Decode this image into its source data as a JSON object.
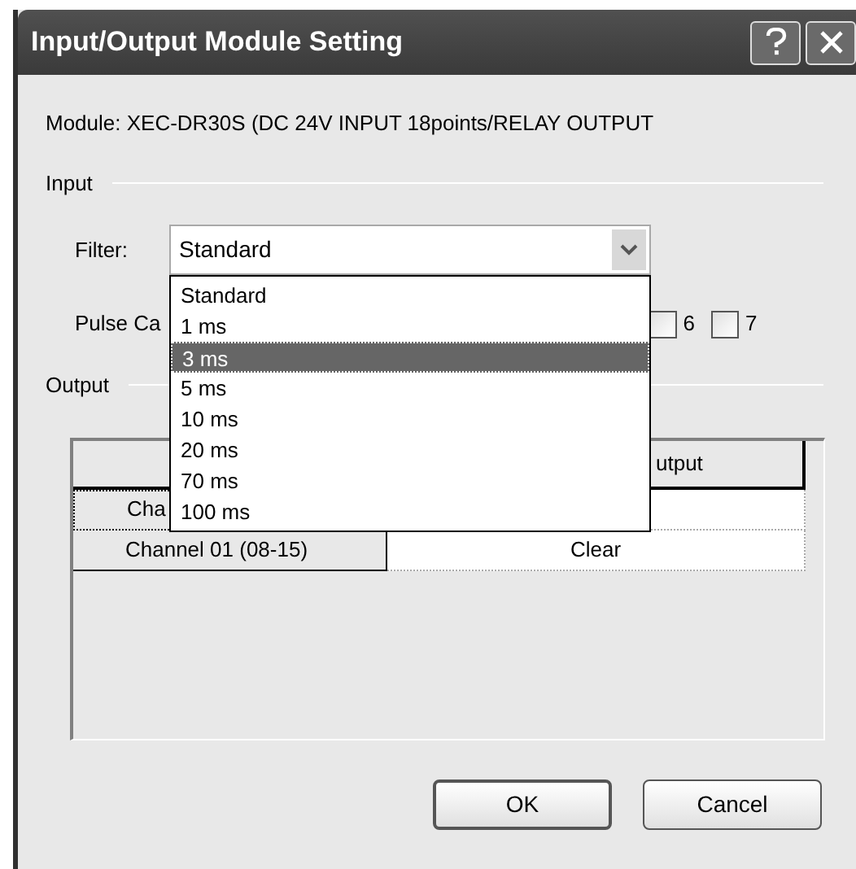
{
  "window": {
    "title": "Input/Output Module Setting"
  },
  "module": "Module: XEC-DR30S (DC 24V INPUT 18points/RELAY OUTPUT",
  "input": {
    "label": "Input",
    "filter_label": "Filter:",
    "filter": {
      "value": "Standard",
      "expanded": true,
      "options": [
        {
          "label": "Standard",
          "highlighted": false
        },
        {
          "label": "1 ms",
          "highlighted": false
        },
        {
          "label": "3 ms",
          "highlighted": true
        },
        {
          "label": "5 ms",
          "highlighted": false
        },
        {
          "label": "10 ms",
          "highlighted": false
        },
        {
          "label": "20 ms",
          "highlighted": false
        },
        {
          "label": "70 ms",
          "highlighted": false
        },
        {
          "label": "100 ms",
          "highlighted": false
        }
      ]
    },
    "pulse_label": "Pulse Ca",
    "pulse_channels": [
      {
        "label": "6",
        "checked": false
      },
      {
        "label": "7",
        "checked": false
      }
    ]
  },
  "output": {
    "label": "Output",
    "table": {
      "column_2": "utput",
      "rows": [
        {
          "channel": "Cha"
        },
        {
          "channel": "Channel 01 (08-15)",
          "value": "Clear"
        }
      ]
    }
  },
  "buttons": [
    "OK",
    "Cancel"
  ]
}
